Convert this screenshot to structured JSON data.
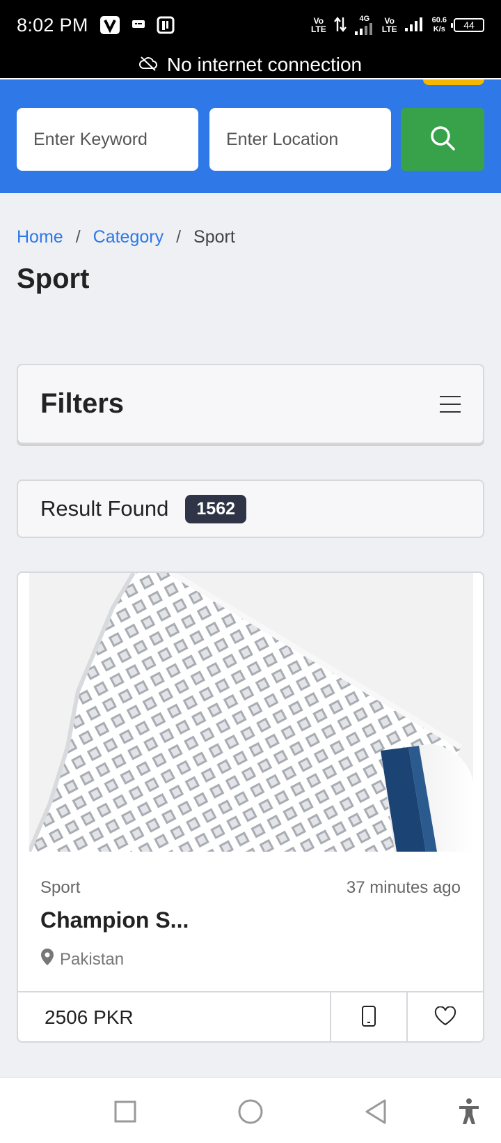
{
  "status_bar": {
    "time": "8:02 PM",
    "volte1": [
      "Vo",
      "LTE"
    ],
    "net_type": "4G",
    "volte2": [
      "Vo",
      "LTE"
    ],
    "net_speed": [
      "60.6",
      "K/s"
    ],
    "battery": "44"
  },
  "offline_banner": {
    "text": "No internet connection",
    "icon": "cloud-off-icon"
  },
  "search": {
    "keyword_placeholder": "Enter Keyword",
    "location_placeholder": "Enter Location",
    "button_icon": "search-icon",
    "button_color": "#37a24a",
    "header_color": "#2e78e8"
  },
  "breadcrumb": {
    "home": "Home",
    "sep": "/",
    "category": "Category",
    "current": "Sport"
  },
  "page_title": "Sport",
  "filters": {
    "title": "Filters",
    "icon": "hamburger-menu-icon"
  },
  "results": {
    "label": "Result Found",
    "count": "1562"
  },
  "listing": {
    "category": "Sport",
    "time_ago": "37 minutes ago",
    "title": "Champion S...",
    "location": "Pakistan",
    "price": "2506 PKR",
    "image": "badminton-shuttlecock-image"
  },
  "nav": {
    "recent": "recent-apps-icon",
    "home": "home-circle-icon",
    "back": "back-triangle-icon",
    "accessibility": "accessibility-icon"
  }
}
